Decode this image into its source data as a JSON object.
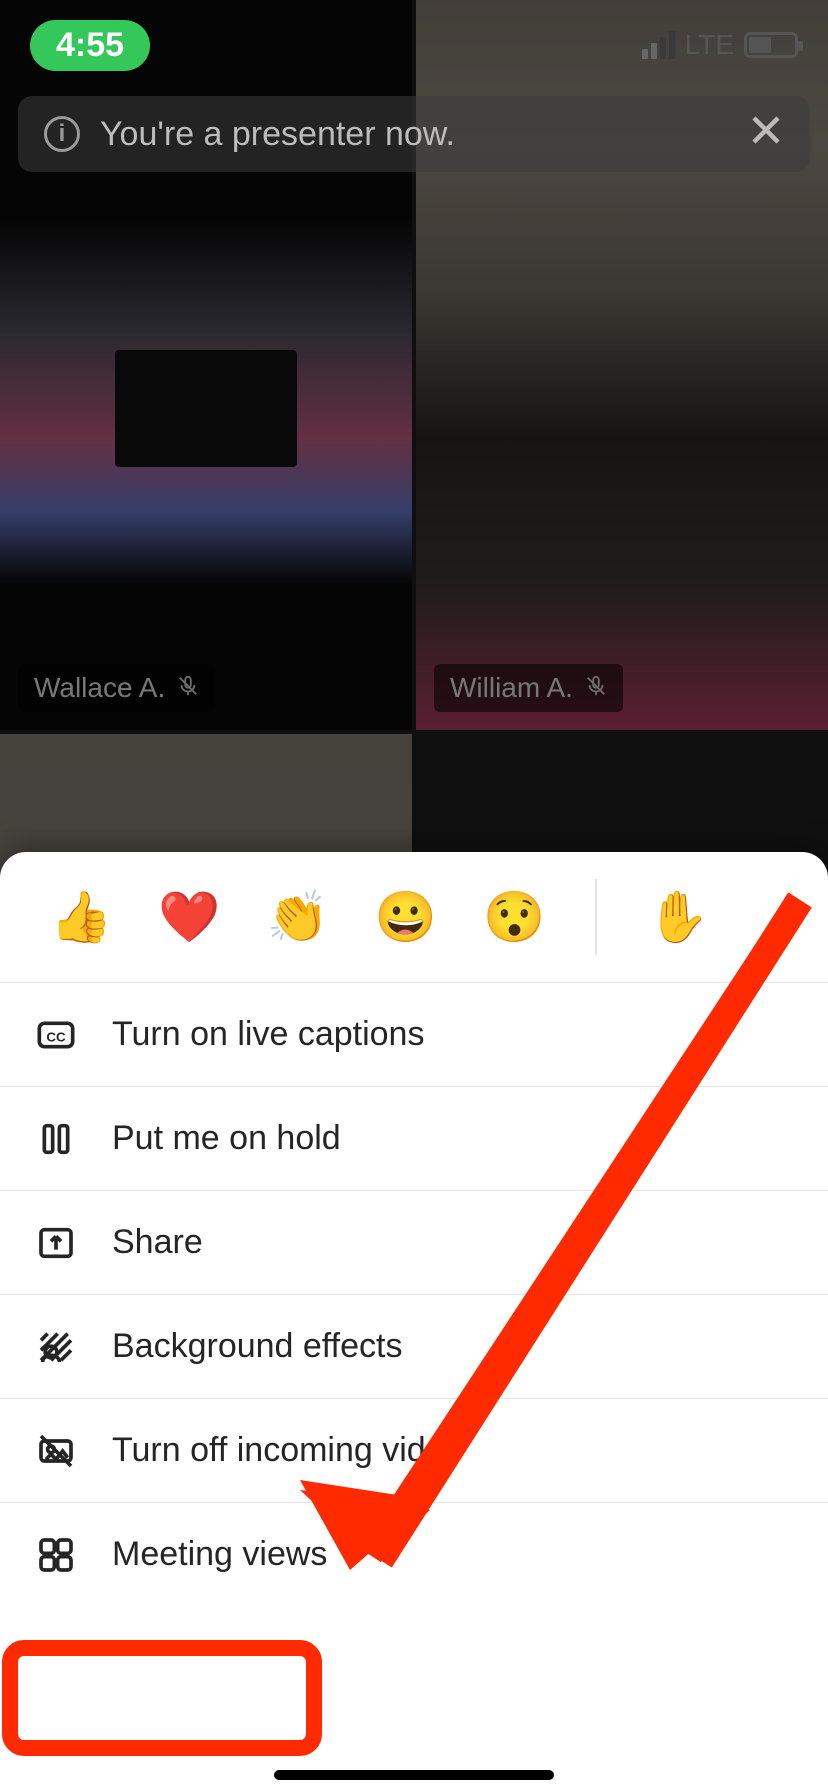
{
  "status": {
    "time": "4:55",
    "network": "LTE"
  },
  "toast": {
    "text": "You're a presenter now."
  },
  "participants": [
    {
      "name": "Wallace A.",
      "muted": true
    },
    {
      "name": "William A.",
      "muted": true
    }
  ],
  "reactions": {
    "items": [
      "thumbs-up",
      "heart",
      "applause",
      "smile",
      "surprised",
      "raise-hand"
    ],
    "glyphs": {
      "thumbs-up": "👍",
      "heart": "❤️",
      "applause": "👏",
      "smile": "😀",
      "surprised": "😯",
      "raise-hand": "✋"
    }
  },
  "menu": {
    "captions": {
      "label": "Turn on live captions"
    },
    "hold": {
      "label": "Put me on hold"
    },
    "share": {
      "label": "Share"
    },
    "bg": {
      "label": "Background effects"
    },
    "incoming": {
      "label": "Turn off incoming video"
    },
    "views": {
      "label": "Meeting views"
    }
  },
  "annotation": {
    "target": "meeting-views-item",
    "color": "#ff2a00"
  }
}
